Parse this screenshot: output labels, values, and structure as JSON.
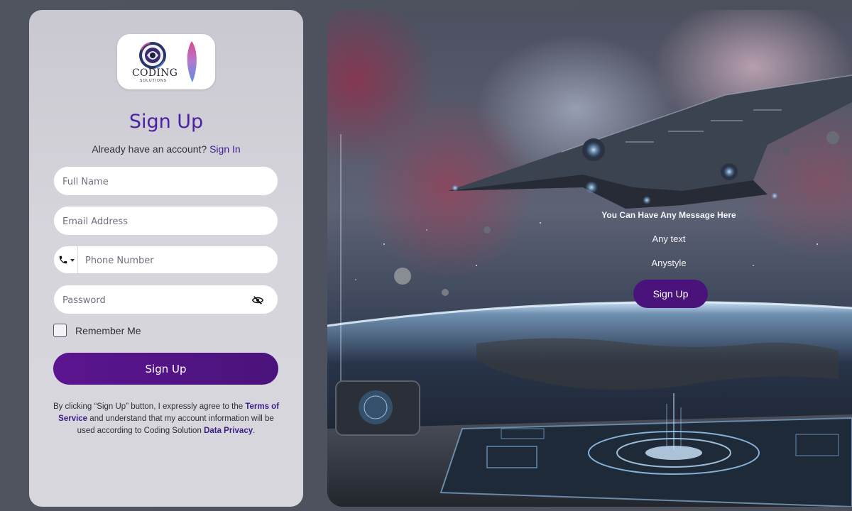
{
  "brand": {
    "logo_text": "CODING",
    "logo_sub": "SOLUTIONS"
  },
  "form": {
    "title": "Sign Up",
    "have_account_text": "Already have an account?",
    "sign_in_link": "Sign In",
    "full_name_placeholder": "Full Name",
    "email_placeholder": "Email Address",
    "phone_placeholder": "Phone Number",
    "password_placeholder": "Password",
    "remember_label": "Remember Me",
    "submit_label": "Sign Up",
    "terms_part1": "By clicking “Sign Up” button, I expressly agree to the",
    "terms_link": "Terms of Service",
    "terms_part2": "and understand that my account information will be used according to Coding Solution",
    "privacy_link": "Data Privacy",
    "terms_end": "."
  },
  "hero": {
    "message_1": "You Can Have Any Message Here",
    "message_2": "Any text",
    "message_3": "Anystyle",
    "button_label": "Sign Up"
  },
  "colors": {
    "accent": "#4a137b",
    "title": "#4b20a3",
    "link": "#3f1f8f"
  },
  "icons": {
    "phone": "phone-icon",
    "password_toggle": "eye-slash-icon"
  }
}
